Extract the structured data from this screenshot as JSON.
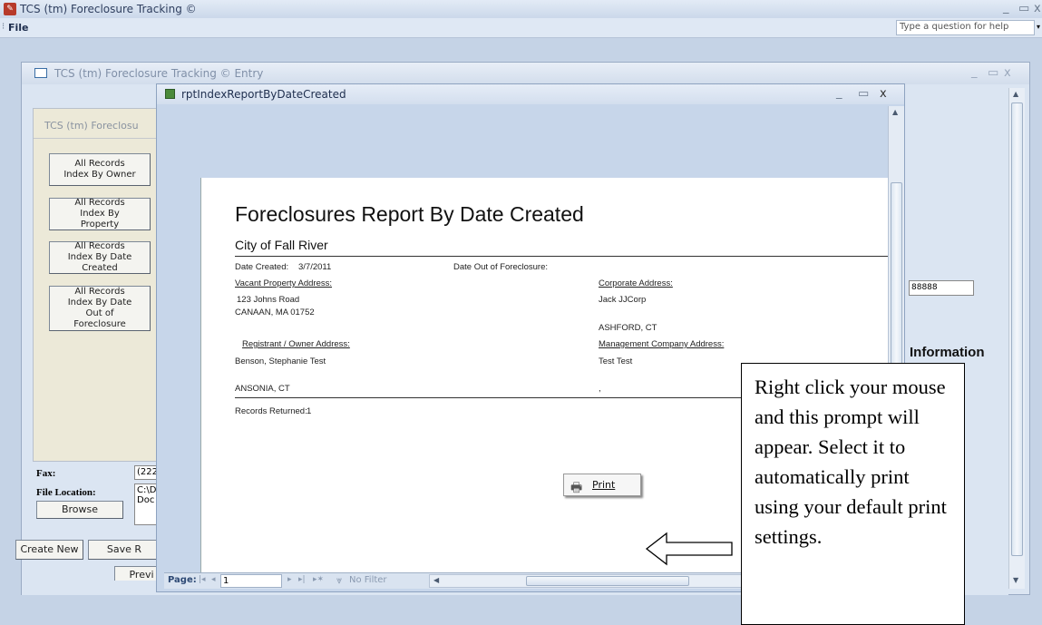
{
  "app": {
    "title": "TCS (tm) Foreclosure Tracking ©",
    "menu_file": "File",
    "help_placeholder": "Type a question for help"
  },
  "entry_window": {
    "title": "TCS (tm) Foreclosure Tracking © Entry",
    "panel_title": "TCS (tm) Foreclosu",
    "index_buttons": [
      "All Records Index By Owner",
      "All Records Index By Property",
      "All Records Index By Date Created",
      "All Records Index By Date Out of Foreclosure"
    ],
    "fax_label": "Fax:",
    "fax_value": "(222",
    "file_location_label": "File Location:",
    "file_location_value": "C:\\D\nDoc",
    "browse_label": "Browse",
    "create_new_label": "Create New",
    "save_label": "Save R",
    "preview_label": "Previ",
    "right_field_value": "88888",
    "information_label": "Information"
  },
  "report_window": {
    "title": "rptIndexReportByDateCreated",
    "report_title": "Foreclosures Report By Date Created",
    "city": "City of Fall River",
    "date_created_label": "Date Created:",
    "date_created_value": "3/7/2011",
    "date_out_label": "Date Out of Foreclosure:",
    "vacant_property_label": "Vacant Property Address:",
    "vacant_line1": "123 Johns Road",
    "vacant_line2": "CANAAN, MA 01752",
    "corporate_label": "Corporate Address:",
    "corporate_line1": "Jack JJCorp",
    "corporate_line2": "ASHFORD, CT",
    "registrant_label": "Registrant / Owner Address:",
    "registrant_line1": "Benson, Stephanie Test",
    "registrant_line2": "ANSONIA, CT",
    "management_label": "Management Company Address:",
    "management_line1": "Test Test",
    "management_line2": ",",
    "records_returned_label": "Records Returned:",
    "records_returned_value": "1",
    "print_menu_label": "Print",
    "nav_page_label": "Page:",
    "nav_page_value": "1",
    "nav_filter_label": "No Filter"
  },
  "callout": {
    "text": "Right click your mouse and this prompt will appear. Select it to automatically print using your default print settings."
  },
  "colors": {
    "titlebar": "#cfdcee",
    "panel": "#ece9d8",
    "report_bg": "#ffffff",
    "accent_blue": "#3a6ea5"
  }
}
